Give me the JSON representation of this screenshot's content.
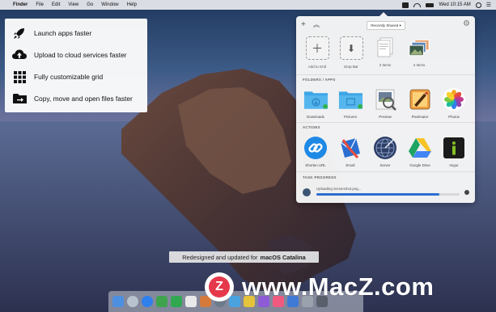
{
  "menubar": {
    "apple": "",
    "items": [
      "Finder",
      "File",
      "Edit",
      "View",
      "Go",
      "Window",
      "Help"
    ],
    "clock": "Wed 10:15 AM"
  },
  "features": [
    {
      "icon": "rocket-icon",
      "label": "Launch apps faster"
    },
    {
      "icon": "cloud-upload-icon",
      "label": "Upload to cloud services faster"
    },
    {
      "icon": "grid-icon",
      "label": "Fully customizable grid"
    },
    {
      "icon": "folder-move-icon",
      "label": "Copy, move and open files faster"
    }
  ],
  "panel": {
    "dropdown": "Recently Shared ▾",
    "shared": [
      {
        "icon": "add-icon",
        "label": "Add to Grid"
      },
      {
        "icon": "drop-bar-icon",
        "label": "Drop Bar"
      },
      {
        "icon": "document-stack-icon",
        "label": "2 Items"
      },
      {
        "icon": "photo-stack-icon",
        "label": "4 Items"
      }
    ],
    "folders_title": "FOLDERS / APPS",
    "folders": [
      {
        "icon": "downloads-folder-icon",
        "label": "Downloads"
      },
      {
        "icon": "pictures-folder-icon",
        "label": "Pictures"
      },
      {
        "icon": "preview-icon",
        "label": "Preview"
      },
      {
        "icon": "pixelmator-icon",
        "label": "Pixelmator"
      },
      {
        "icon": "photos-icon",
        "label": "Photos"
      }
    ],
    "actions_title": "ACTIONS",
    "actions": [
      {
        "icon": "link-icon",
        "label": "Shorten URL"
      },
      {
        "icon": "email-icon",
        "label": "Email"
      },
      {
        "icon": "server-icon",
        "label": "Server"
      },
      {
        "icon": "google-drive-icon",
        "label": "Google Drive"
      },
      {
        "icon": "imgur-icon",
        "label": "Imgur"
      }
    ],
    "progress_title": "TASK PROGRESS",
    "progress_text": "Uploading Screenshot.png...",
    "progress": 0.86
  },
  "caption": {
    "text": "Redesigned and updated for",
    "emphasis": "macOS Catalina"
  },
  "watermark": {
    "logo": "Z",
    "text": "www.MacZ.com"
  },
  "colors": {
    "accent": "#2b6fd1",
    "watermark_logo": "#e5384a",
    "folder": "#3ea6e6"
  }
}
